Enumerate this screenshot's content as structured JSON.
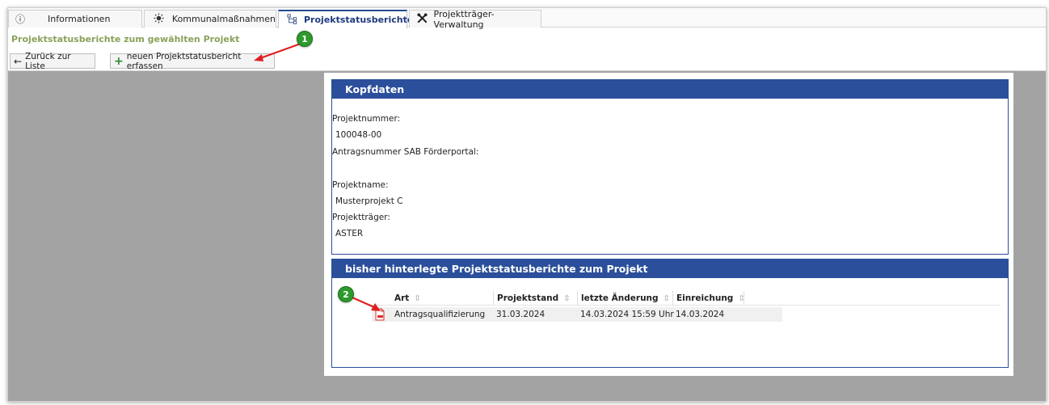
{
  "tabs": [
    {
      "label": "Informationen",
      "icon": "info-icon"
    },
    {
      "label": "Kommunalmaßnahmen",
      "icon": "bulb-icon"
    },
    {
      "label": "Projektstatusberichte",
      "icon": "hierarchy-icon"
    },
    {
      "label": "Projektträger-Verwaltung",
      "icon": "tools-icon"
    }
  ],
  "header": {
    "subtitle": "Projektstatusberichte zum gewählten Projekt",
    "back_label": "Zurück zur Liste",
    "new_label": "neuen Projektstatusbericht erfassen"
  },
  "kopfdaten": {
    "title": "Kopfdaten",
    "projektnummer_label": "Projektnummer:",
    "projektnummer": "100048-00",
    "antragsnummer_label": "Antragsnummer SAB Förderportal:",
    "antragsnummer": "",
    "projektname_label": "Projektname:",
    "projektname": "Musterprojekt C",
    "projekttraeger_label": "Projektträger:",
    "projekttraeger": "ASTER"
  },
  "berichte": {
    "title": "bisher hinterlegte Projektstatusberichte zum Projekt",
    "columns": [
      "Art",
      "Projektstand",
      "letzte Änderung",
      "Einreichung"
    ],
    "rows": [
      {
        "art": "Antragsqualifizierung",
        "projektstand": "31.03.2024",
        "letzte_aenderung": "14.03.2024 15:59 Uhr",
        "einreichung": "14.03.2024"
      }
    ]
  },
  "callouts": [
    "1",
    "2"
  ],
  "colors": {
    "accent": "#2b4f9a",
    "subtitle": "#8aa15a",
    "callout": "#2c9a2c",
    "arrow": "#e02020"
  }
}
